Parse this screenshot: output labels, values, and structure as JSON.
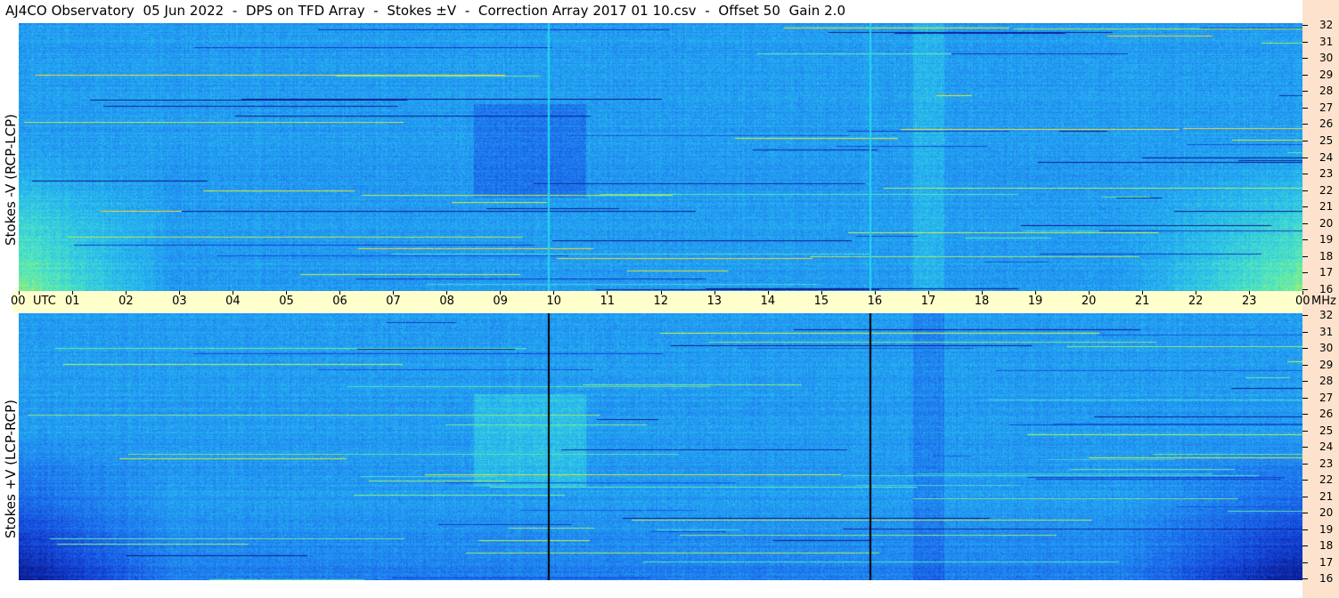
{
  "title": "AJ4CO Observatory  05 Jun 2022  -  DPS on TFD Array  -  Stokes ±V  -  Correction Array 2017 01 10.csv  -  Offset 50  Gain 2.0",
  "chart_data": [
    {
      "type": "heatmap",
      "name": "top-panel",
      "ylabel": "Stokes -V (RCP-LCP)",
      "xlabel": "UTC",
      "x_ticks": [
        "00",
        "01",
        "02",
        "03",
        "04",
        "05",
        "06",
        "07",
        "08",
        "09",
        "10",
        "11",
        "12",
        "13",
        "14",
        "15",
        "16",
        "17",
        "18",
        "19",
        "20",
        "21",
        "22",
        "23",
        "00"
      ],
      "x_range_hours": [
        0,
        24
      ],
      "y_ticks_mhz": [
        16,
        17,
        18,
        19,
        20,
        21,
        22,
        23,
        24,
        25,
        26,
        27,
        28,
        29,
        30,
        31,
        32
      ],
      "y_range_mhz": [
        16,
        32
      ],
      "y_unit": "MHz",
      "colormap": [
        "#0a1a8c",
        "#1444d8",
        "#1f7ef0",
        "#26b8f0",
        "#4fe8c0",
        "#c8f040",
        "#ffe020",
        "#ff40a0"
      ],
      "marker_lines_utc": [
        9.9,
        15.9
      ],
      "marker_line_color": "#22d8e8"
    },
    {
      "type": "heatmap",
      "name": "bottom-panel",
      "ylabel": "Stokes +V (LCP-RCP)",
      "xlabel": "UTC",
      "x_ticks": [
        "00",
        "01",
        "02",
        "03",
        "04",
        "05",
        "06",
        "07",
        "08",
        "09",
        "10",
        "11",
        "12",
        "13",
        "14",
        "15",
        "16",
        "17",
        "18",
        "19",
        "20",
        "21",
        "22",
        "23",
        "00"
      ],
      "x_range_hours": [
        0,
        24
      ],
      "y_ticks_mhz": [
        16,
        17,
        18,
        19,
        20,
        21,
        22,
        23,
        24,
        25,
        26,
        27,
        28,
        29,
        30,
        31,
        32
      ],
      "y_range_mhz": [
        16,
        32
      ],
      "y_unit": "MHz",
      "colormap": [
        "#0a1a8c",
        "#1444d8",
        "#1f7ef0",
        "#26b8f0",
        "#4fe8c0",
        "#c8f040",
        "#ffe020",
        "#ff40a0"
      ],
      "marker_lines_utc": [
        9.9,
        15.9
      ],
      "marker_line_color": "#000000"
    }
  ],
  "axis": {
    "utc_label": "UTC",
    "mhz_label": "MHz"
  }
}
